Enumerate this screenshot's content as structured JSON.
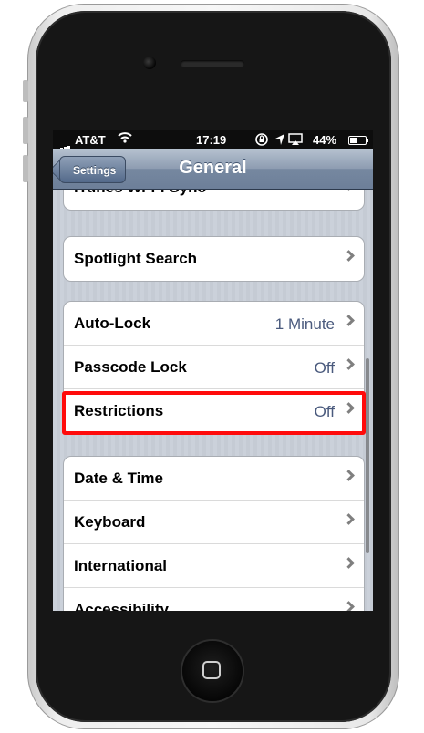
{
  "status_bar": {
    "carrier": "AT&T",
    "time": "17:19",
    "battery": "44%",
    "battery_level": 0.44
  },
  "nav_bar": {
    "back_label": "Settings",
    "title": "General"
  },
  "groups": [
    {
      "rows": [
        {
          "label": "iTunes Wi-Fi Sync",
          "value": ""
        }
      ]
    },
    {
      "rows": [
        {
          "label": "Spotlight Search",
          "value": ""
        }
      ]
    },
    {
      "rows": [
        {
          "label": "Auto-Lock",
          "value": "1 Minute"
        },
        {
          "label": "Passcode Lock",
          "value": "Off"
        },
        {
          "label": "Restrictions",
          "value": "Off"
        }
      ]
    },
    {
      "rows": [
        {
          "label": "Date & Time",
          "value": ""
        },
        {
          "label": "Keyboard",
          "value": ""
        },
        {
          "label": "International",
          "value": ""
        },
        {
          "label": "Accessibility",
          "value": ""
        }
      ]
    }
  ],
  "highlight_color": "#ff0b0b"
}
